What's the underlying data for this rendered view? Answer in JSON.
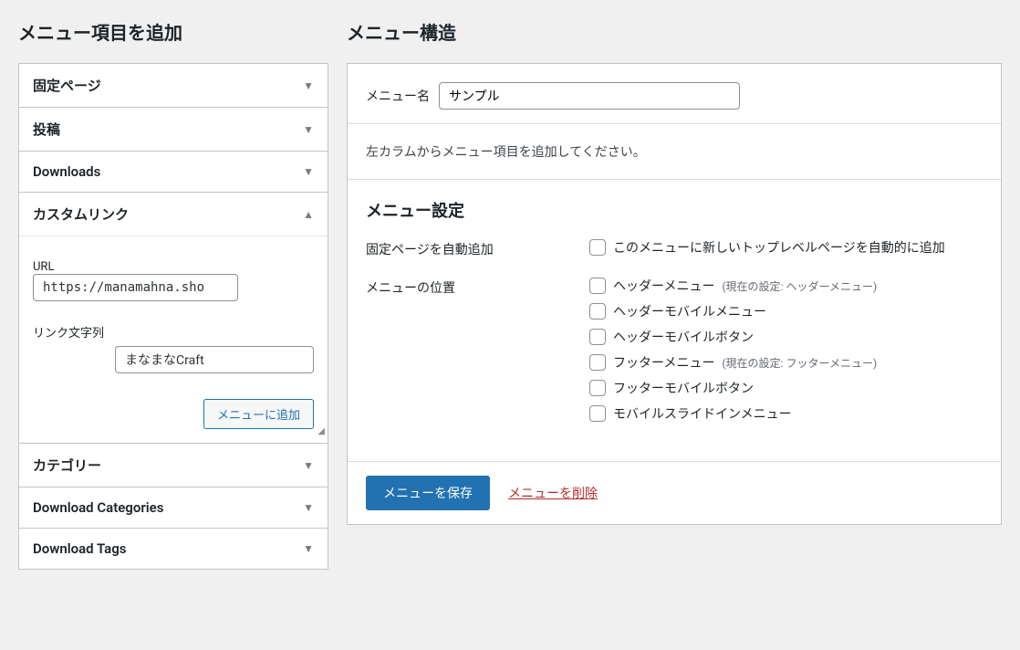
{
  "left": {
    "title": "メニュー項目を追加",
    "accordion": [
      {
        "label": "固定ページ",
        "expanded": false
      },
      {
        "label": "投稿",
        "expanded": false
      },
      {
        "label": "Downloads",
        "expanded": false
      },
      {
        "label": "カスタムリンク",
        "expanded": true
      },
      {
        "label": "カテゴリー",
        "expanded": false
      },
      {
        "label": "Download Categories",
        "expanded": false
      },
      {
        "label": "Download Tags",
        "expanded": false
      }
    ],
    "custom_link": {
      "url_label": "URL",
      "url_value": "https://manamahna.sho",
      "link_text_label": "リンク文字列",
      "link_text_value": "まなまなCraft",
      "add_button": "メニューに追加"
    }
  },
  "right": {
    "title": "メニュー構造",
    "menu_name_label": "メニュー名",
    "menu_name_value": "サンプル",
    "instruction": "左カラムからメニュー項目を追加してください。",
    "settings": {
      "title": "メニュー設定",
      "auto_add_label": "固定ページを自動追加",
      "auto_add_option": "このメニューに新しいトップレベルページを自動的に追加",
      "location_label": "メニューの位置",
      "locations": [
        {
          "label": "ヘッダーメニュー",
          "hint": "(現在の設定: ヘッダーメニュー)"
        },
        {
          "label": "ヘッダーモバイルメニュー",
          "hint": ""
        },
        {
          "label": "ヘッダーモバイルボタン",
          "hint": ""
        },
        {
          "label": "フッターメニュー",
          "hint": "(現在の設定: フッターメニュー)"
        },
        {
          "label": "フッターモバイルボタン",
          "hint": ""
        },
        {
          "label": "モバイルスライドインメニュー",
          "hint": ""
        }
      ]
    },
    "save_button": "メニューを保存",
    "delete_link": "メニューを削除"
  }
}
